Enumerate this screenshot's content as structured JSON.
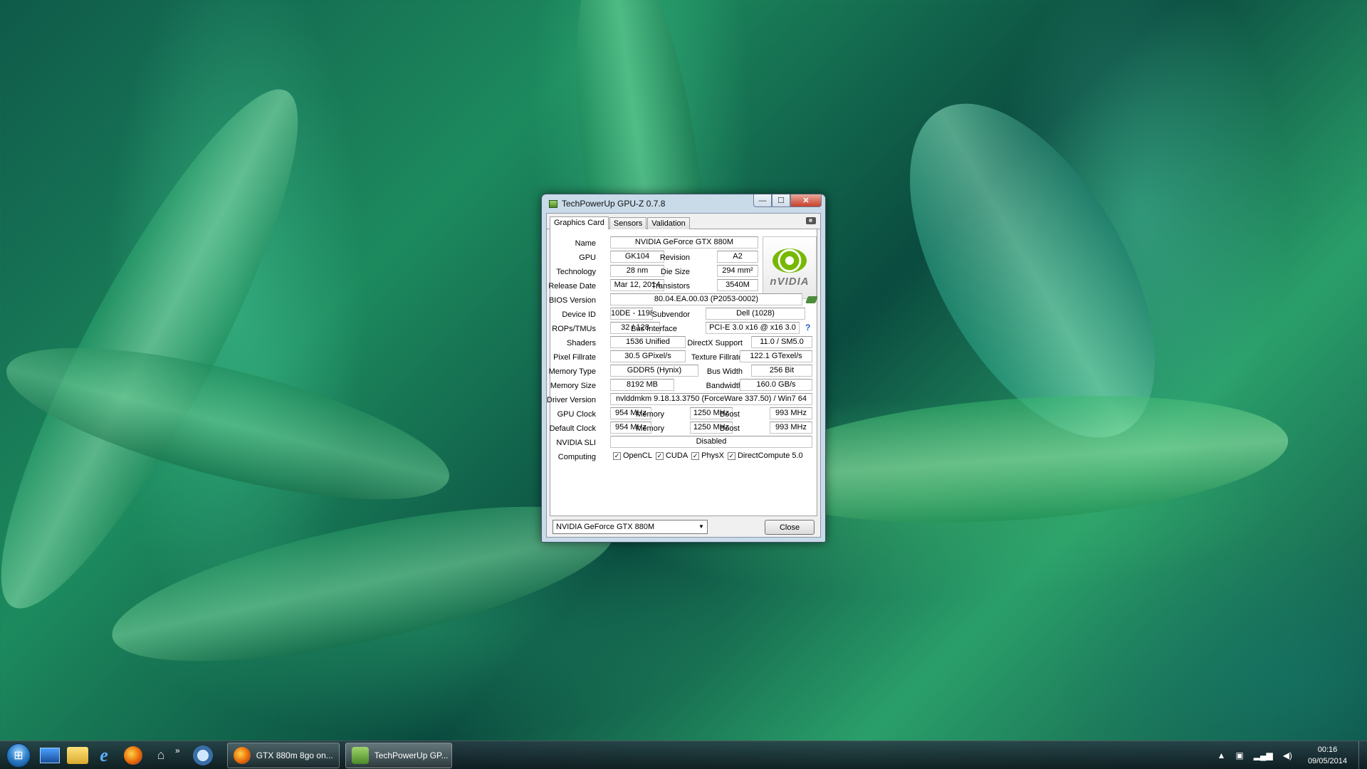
{
  "window": {
    "title": "TechPowerUp GPU-Z 0.7.8",
    "minimize": "—",
    "maximize": "☐",
    "close": "✕"
  },
  "tabs": [
    "Graphics Card",
    "Sensors",
    "Validation"
  ],
  "labels": {
    "name": "Name",
    "gpu": "GPU",
    "revision": "Revision",
    "technology": "Technology",
    "die_size": "Die Size",
    "release_date": "Release Date",
    "transistors": "Transistors",
    "bios_version": "BIOS Version",
    "device_id": "Device ID",
    "subvendor": "Subvendor",
    "rops_tmus": "ROPs/TMUs",
    "bus_interface": "Bus Interface",
    "shaders": "Shaders",
    "directx": "DirectX Support",
    "pixel_fillrate": "Pixel Fillrate",
    "texture_fillrate": "Texture Fillrate",
    "memory_type": "Memory Type",
    "bus_width": "Bus Width",
    "memory_size": "Memory Size",
    "bandwidth": "Bandwidth",
    "driver_version": "Driver Version",
    "gpu_clock": "GPU Clock",
    "default_clock": "Default Clock",
    "memory": "Memory",
    "boost": "Boost",
    "nvidia_sli": "NVIDIA SLI",
    "computing": "Computing"
  },
  "values": {
    "name": "NVIDIA GeForce GTX 880M",
    "gpu": "GK104",
    "revision": "A2",
    "technology": "28 nm",
    "die_size": "294 mm²",
    "release_date": "Mar 12, 2014",
    "transistors": "3540M",
    "bios_version": "80.04.EA.00.03 (P2053-0002)",
    "device_id": "10DE - 1198",
    "subvendor": "Dell (1028)",
    "rops_tmus": "32 / 128",
    "bus_interface": "PCI-E 3.0 x16 @ x16 3.0",
    "shaders": "1536 Unified",
    "directx": "11.0 / SM5.0",
    "pixel_fillrate": "30.5 GPixel/s",
    "texture_fillrate": "122.1 GTexel/s",
    "memory_type": "GDDR5 (Hynix)",
    "bus_width": "256 Bit",
    "memory_size": "8192 MB",
    "bandwidth": "160.0 GB/s",
    "driver_version": "nvlddmkm 9.18.13.3750 (ForceWare 337.50) / Win7 64",
    "gpu_clock": "954 MHz",
    "gpu_memory": "1250 MHz",
    "gpu_boost": "993 MHz",
    "default_clock": "954 MHz",
    "default_memory": "1250 MHz",
    "default_boost": "993 MHz",
    "nvidia_sli": "Disabled"
  },
  "computing": [
    "OpenCL",
    "CUDA",
    "PhysX",
    "DirectCompute 5.0"
  ],
  "check_mark": "✓",
  "help_mark": "?",
  "logo_text": "nVIDIA",
  "device_select": "NVIDIA GeForce GTX 880M",
  "close_button": "Close",
  "taskbar": {
    "items": [
      "GTX 880m 8go on...",
      "TechPowerUp GP..."
    ],
    "overflow": "»",
    "tray_arrow": "▲",
    "time": "00:16",
    "date": "09/05/2014"
  },
  "colors": {
    "nvidia_green": "#76b900",
    "help_blue": "#1e5fc2"
  }
}
